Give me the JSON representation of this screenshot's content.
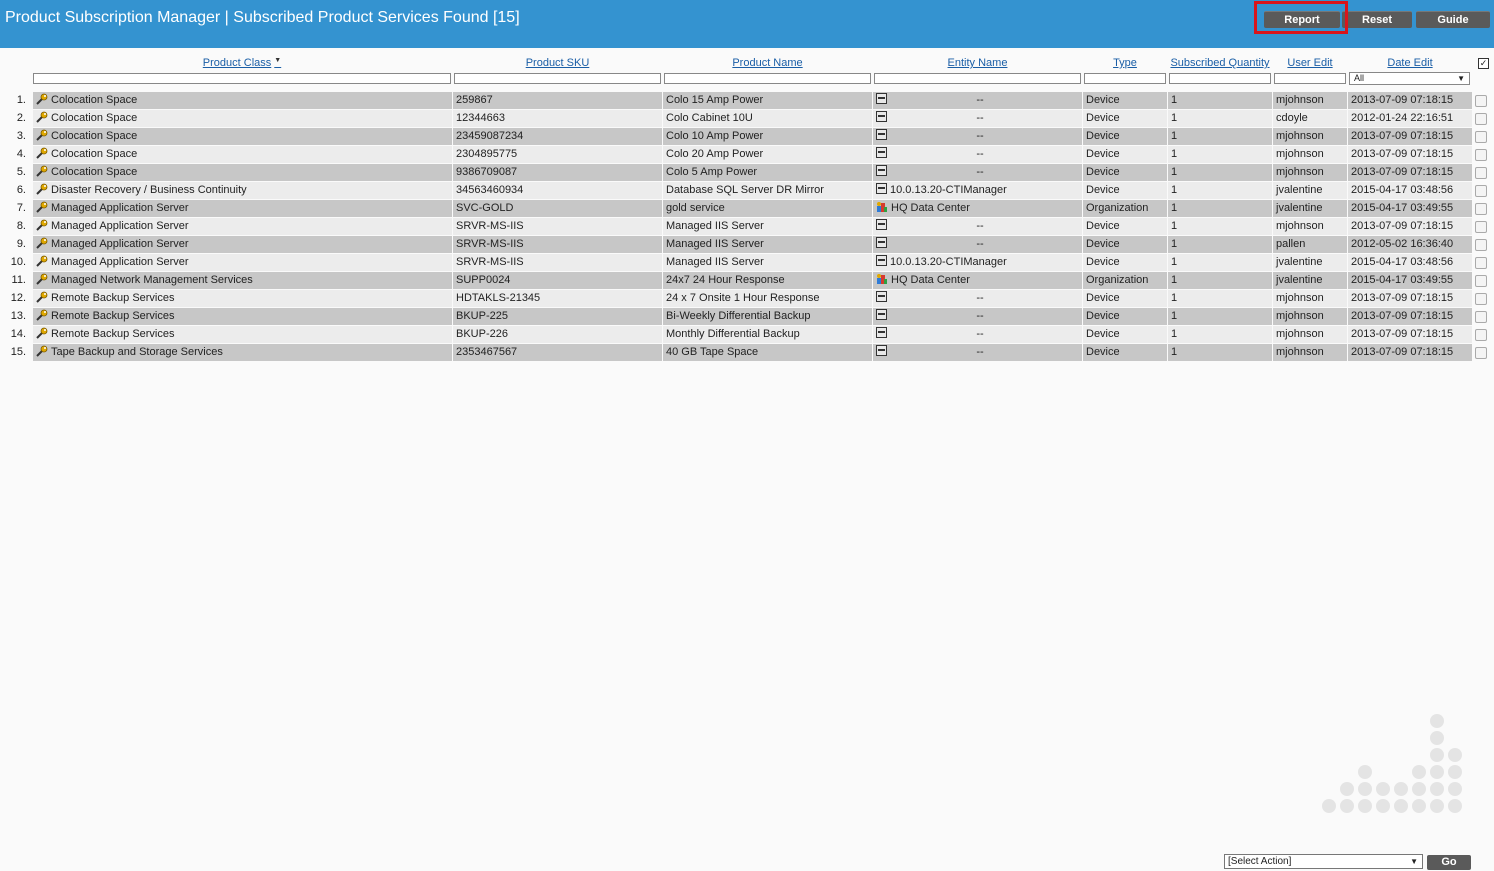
{
  "header": {
    "title": "Product Subscription Manager | Subscribed Product Services Found [15]",
    "buttons": {
      "report": "Report",
      "reset": "Reset",
      "guide": "Guide"
    }
  },
  "columns": {
    "product_class": "Product Class",
    "product_sku": "Product SKU",
    "product_name": "Product Name",
    "entity_name": "Entity Name",
    "type": "Type",
    "subscribed_quantity": "Subscribed Quantity",
    "user_edit": "User Edit",
    "date_edit": "Date Edit"
  },
  "filters": {
    "date_edit_selected": "All"
  },
  "rows": [
    {
      "num": "1.",
      "product_class": "Colocation Space",
      "sku": "259867",
      "name": "Colo 15 Amp Power",
      "entity_icon": "device-icon",
      "entity": "--",
      "type": "Device",
      "qty": "1",
      "user": "mjohnson",
      "date": "2013-07-09 07:18:15"
    },
    {
      "num": "2.",
      "product_class": "Colocation Space",
      "sku": "12344663",
      "name": "Colo Cabinet 10U",
      "entity_icon": "device-icon",
      "entity": "--",
      "type": "Device",
      "qty": "1",
      "user": "cdoyle",
      "date": "2012-01-24 22:16:51"
    },
    {
      "num": "3.",
      "product_class": "Colocation Space",
      "sku": "23459087234",
      "name": "Colo 10 Amp Power",
      "entity_icon": "device-icon",
      "entity": "--",
      "type": "Device",
      "qty": "1",
      "user": "mjohnson",
      "date": "2013-07-09 07:18:15"
    },
    {
      "num": "4.",
      "product_class": "Colocation Space",
      "sku": "2304895775",
      "name": "Colo 20 Amp Power",
      "entity_icon": "device-icon",
      "entity": "--",
      "type": "Device",
      "qty": "1",
      "user": "mjohnson",
      "date": "2013-07-09 07:18:15"
    },
    {
      "num": "5.",
      "product_class": "Colocation Space",
      "sku": "9386709087",
      "name": "Colo 5 Amp Power",
      "entity_icon": "device-icon",
      "entity": "--",
      "type": "Device",
      "qty": "1",
      "user": "mjohnson",
      "date": "2013-07-09 07:18:15"
    },
    {
      "num": "6.",
      "product_class": "Disaster Recovery / Business Continuity",
      "sku": "34563460934",
      "name": "Database SQL Server DR Mirror",
      "entity_icon": "device-icon",
      "entity": "10.0.13.20-CTIManager",
      "type": "Device",
      "qty": "1",
      "user": "jvalentine",
      "date": "2015-04-17 03:48:56"
    },
    {
      "num": "7.",
      "product_class": "Managed Application Server",
      "sku": "SVC-GOLD",
      "name": "gold service",
      "entity_icon": "organization-icon",
      "entity": "HQ Data Center",
      "type": "Organization",
      "qty": "1",
      "user": "jvalentine",
      "date": "2015-04-17 03:49:55"
    },
    {
      "num": "8.",
      "product_class": "Managed Application Server",
      "sku": "SRVR-MS-IIS",
      "name": "Managed IIS Server",
      "entity_icon": "device-icon",
      "entity": "--",
      "type": "Device",
      "qty": "1",
      "user": "mjohnson",
      "date": "2013-07-09 07:18:15"
    },
    {
      "num": "9.",
      "product_class": "Managed Application Server",
      "sku": "SRVR-MS-IIS",
      "name": "Managed IIS Server",
      "entity_icon": "device-icon",
      "entity": "--",
      "type": "Device",
      "qty": "1",
      "user": "pallen",
      "date": "2012-05-02 16:36:40"
    },
    {
      "num": "10.",
      "product_class": "Managed Application Server",
      "sku": "SRVR-MS-IIS",
      "name": "Managed IIS Server",
      "entity_icon": "device-icon",
      "entity": "10.0.13.20-CTIManager",
      "type": "Device",
      "qty": "1",
      "user": "jvalentine",
      "date": "2015-04-17 03:48:56"
    },
    {
      "num": "11.",
      "product_class": "Managed Network Management Services",
      "sku": "SUPP0024",
      "name": "24x7 24 Hour Response",
      "entity_icon": "organization-icon",
      "entity": "HQ Data Center",
      "type": "Organization",
      "qty": "1",
      "user": "jvalentine",
      "date": "2015-04-17 03:49:55"
    },
    {
      "num": "12.",
      "product_class": "Remote Backup Services",
      "sku": "HDTAKLS-21345",
      "name": "24 x 7 Onsite 1 Hour Response",
      "entity_icon": "device-icon",
      "entity": "--",
      "type": "Device",
      "qty": "1",
      "user": "mjohnson",
      "date": "2013-07-09 07:18:15"
    },
    {
      "num": "13.",
      "product_class": "Remote Backup Services",
      "sku": "BKUP-225",
      "name": "Bi-Weekly Differential Backup",
      "entity_icon": "device-icon",
      "entity": "--",
      "type": "Device",
      "qty": "1",
      "user": "mjohnson",
      "date": "2013-07-09 07:18:15"
    },
    {
      "num": "14.",
      "product_class": "Remote Backup Services",
      "sku": "BKUP-226",
      "name": "Monthly Differential Backup",
      "entity_icon": "device-icon",
      "entity": "--",
      "type": "Device",
      "qty": "1",
      "user": "mjohnson",
      "date": "2013-07-09 07:18:15"
    },
    {
      "num": "15.",
      "product_class": "Tape Backup and Storage Services",
      "sku": "2353467567",
      "name": "40 GB Tape Space",
      "entity_icon": "device-icon",
      "entity": "--",
      "type": "Device",
      "qty": "1",
      "user": "mjohnson",
      "date": "2013-07-09 07:18:15"
    }
  ],
  "footer": {
    "action_select": "[Select Action]",
    "go": "Go"
  },
  "colors": {
    "header_bg": "#3493d0",
    "highlight": "#d9151c",
    "link": "#1a5ea6"
  }
}
